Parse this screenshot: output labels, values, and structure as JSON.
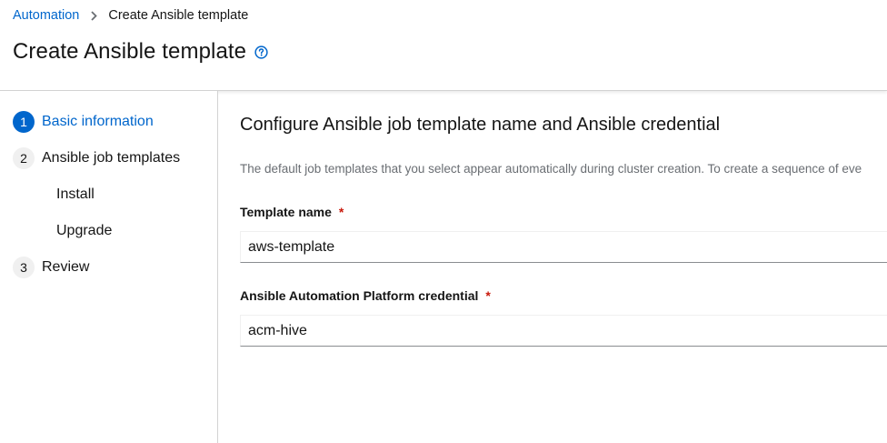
{
  "breadcrumb": {
    "parent": "Automation",
    "current": "Create Ansible template"
  },
  "header": {
    "title": "Create Ansible template",
    "help_icon": "question-circle-icon"
  },
  "wizard_nav": {
    "steps": [
      {
        "number": "1",
        "label": "Basic information",
        "active": true
      },
      {
        "number": "2",
        "label": "Ansible job templates",
        "active": false,
        "substeps": [
          "Install",
          "Upgrade"
        ]
      },
      {
        "number": "3",
        "label": "Review",
        "active": false
      }
    ]
  },
  "main": {
    "section_title": "Configure Ansible job template name and Ansible credential",
    "description": "The default job templates that you select appear automatically during cluster creation. To create a sequence of eve",
    "fields": [
      {
        "label": "Template name",
        "required_mark": "*",
        "value": "aws-template"
      },
      {
        "label": "Ansible Automation Platform credential",
        "required_mark": "*",
        "value": "acm-hive"
      }
    ]
  },
  "colors": {
    "link": "#0066cc",
    "active_step": "#0066cc",
    "required": "#c9190b",
    "muted_text": "#6a6e73",
    "border": "#d2d2d2"
  }
}
